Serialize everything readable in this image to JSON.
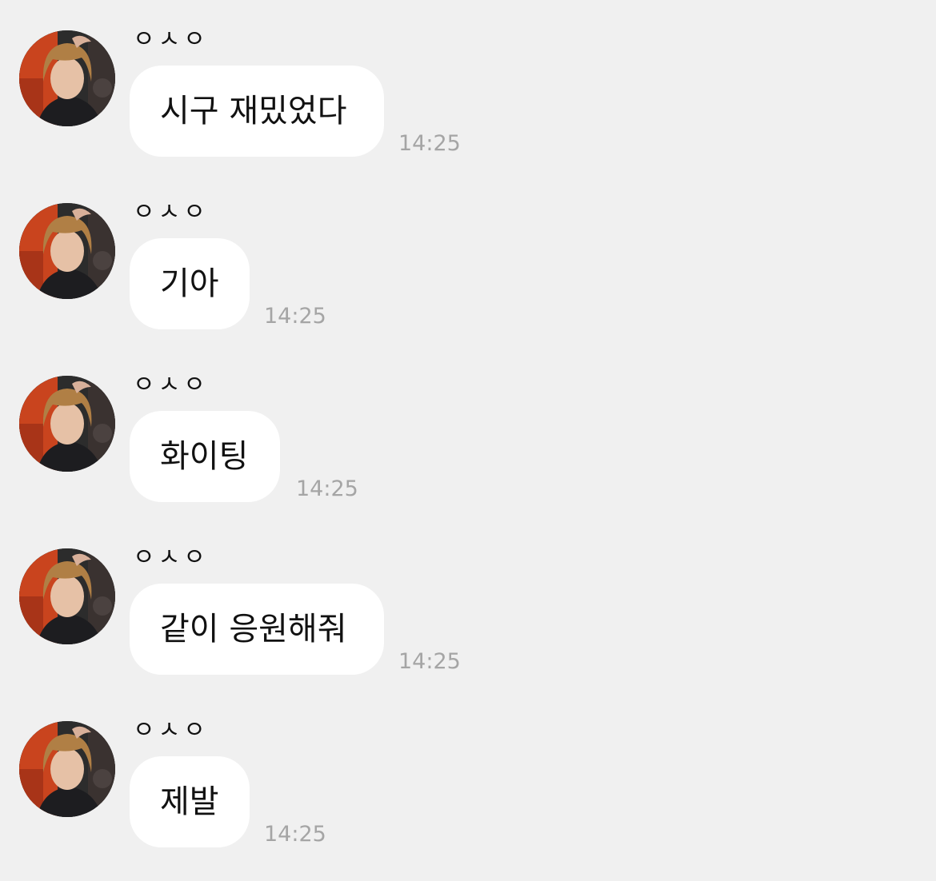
{
  "chat": {
    "messages": [
      {
        "sender": "ㅇㅅㅇ",
        "text": "시구 재밌었다",
        "time": "14:25"
      },
      {
        "sender": "ㅇㅅㅇ",
        "text": "기아",
        "time": "14:25"
      },
      {
        "sender": "ㅇㅅㅇ",
        "text": "화이팅",
        "time": "14:25"
      },
      {
        "sender": "ㅇㅅㅇ",
        "text": "같이 응원해줘",
        "time": "14:25"
      },
      {
        "sender": "ㅇㅅㅇ",
        "text": "제발",
        "time": "14:25"
      }
    ]
  },
  "colors": {
    "background": "#f0f0f0",
    "bubble": "#ffffff",
    "text": "#111111",
    "timestamp": "#a5a5a5"
  },
  "icons": {
    "avatar": "profile-photo"
  }
}
